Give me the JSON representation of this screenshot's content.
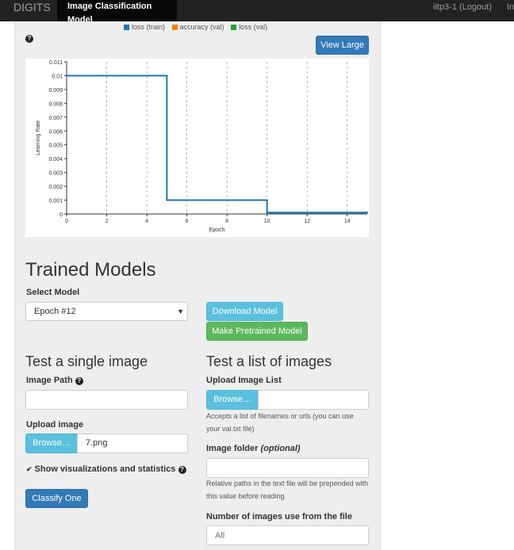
{
  "navbar": {
    "brand": "DIGITS",
    "active_tab": "Image Classification Model",
    "user_link": "iitp3-1 (Logout)",
    "extra_link": "In"
  },
  "chart_section": {
    "view_large_label": "View Large",
    "legend": [
      {
        "name": "loss (train)",
        "color": "#1f77b4"
      },
      {
        "name": "accuracy (val)",
        "color": "#ff7f0e"
      },
      {
        "name": "loss (val)",
        "color": "#2ca02c"
      }
    ]
  },
  "chart_data": {
    "type": "line",
    "title": "",
    "xlabel": "Epoch",
    "ylabel": "Learning Rate",
    "xlim": [
      0,
      15
    ],
    "ylim": [
      0,
      0.011
    ],
    "x_ticks": [
      "0",
      "2",
      "4",
      "6",
      "8",
      "10",
      "12",
      "14"
    ],
    "y_ticks": [
      "0",
      "0.001",
      "0.002",
      "0.003",
      "0.004",
      "0.005",
      "0.006",
      "0.007",
      "0.008",
      "0.009",
      "0.01",
      "0.011"
    ],
    "vertical_gridlines_at_epochs": [
      2,
      4,
      6,
      8,
      10,
      12,
      14
    ],
    "series": [
      {
        "color": "#1f77b4",
        "points": [
          [
            0,
            0.01
          ],
          [
            5,
            0.01
          ],
          [
            5,
            0.001
          ],
          [
            10,
            0.001
          ],
          [
            10,
            0.0001
          ],
          [
            15,
            0.0001
          ]
        ]
      }
    ]
  },
  "trained_models": {
    "heading": "Trained Models",
    "select_label": "Select Model",
    "selected_model": "Epoch #12",
    "download_label": "Download Model",
    "pretrained_label": "Make Pretrained Model"
  },
  "single_image": {
    "heading": "Test a single image",
    "image_path_label": "Image Path",
    "image_path_value": "",
    "upload_label": "Upload image",
    "browse_label": "Browse…",
    "upload_file": "7.png",
    "show_vis_label": "Show visualizations and statistics",
    "show_vis_checked": true,
    "classify_label": "Classify One"
  },
  "list_images": {
    "heading": "Test a list of images",
    "upload_list_label": "Upload Image List",
    "browse_label": "Browse…",
    "upload_help": "Accepts a list of filenames or urls (you can use your val.txt file)",
    "folder_label": "Image folder",
    "folder_optional": "(optional)",
    "folder_help": "Relative paths in the text file will be prepended with this value before reading",
    "num_images_label": "Number of images use from the file",
    "num_images_placeholder": "All"
  }
}
